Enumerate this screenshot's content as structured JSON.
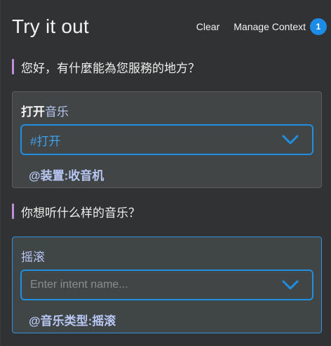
{
  "header": {
    "title": "Try it out",
    "clear_label": "Clear",
    "manage_context_label": "Manage Context",
    "context_count": "1"
  },
  "conversation": [
    {
      "utterance": "您好，有什麼能為您服務的地方？",
      "user_text_plain": "打开",
      "user_text_entity": "音乐",
      "intent_value": "#打开",
      "intent_placeholder": "",
      "entity_tag": "@装置:收音机"
    },
    {
      "utterance": "你想听什么样的音乐？",
      "user_text_plain": "",
      "user_text_entity": "摇滚",
      "intent_value": "",
      "intent_placeholder": "Enter intent name...",
      "entity_tag": "@音乐类型:摇滚"
    }
  ],
  "colors": {
    "accent": "#1f8fe1",
    "utterance_bar": "#c48ddc",
    "entity_text": "#b8c7f4",
    "badge": "#1c8ce6"
  },
  "icons": {
    "dropdown": "chevron-down-icon"
  }
}
